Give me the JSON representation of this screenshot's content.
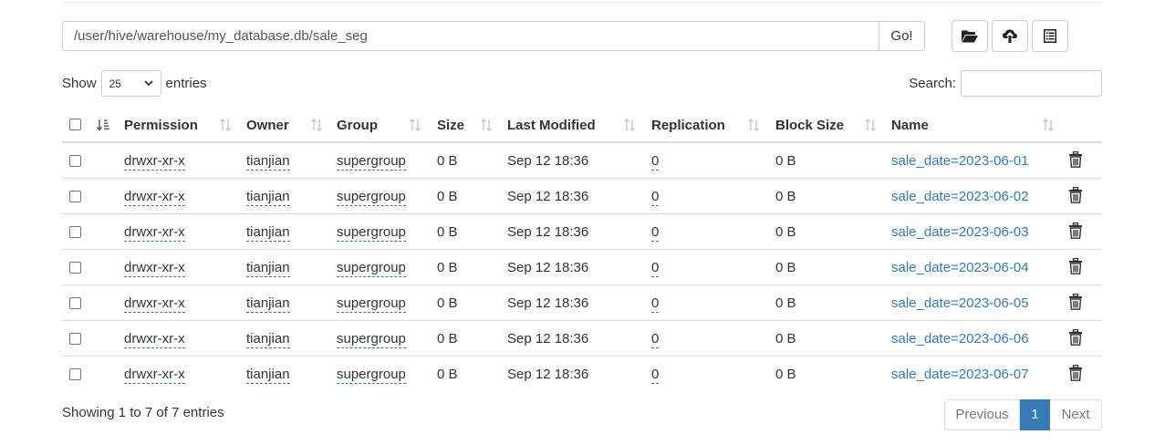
{
  "path": {
    "value": "/user/hive/warehouse/my_database.db/sale_seg",
    "go_label": "Go!"
  },
  "toolbar": {
    "browse_icon": "folder-open-icon",
    "upload_icon": "upload-icon",
    "list_icon": "list-icon"
  },
  "length": {
    "show_label": "Show",
    "selected": "25",
    "entries_label": "entries"
  },
  "search": {
    "label": "Search:",
    "value": ""
  },
  "table": {
    "headers": {
      "permission": "Permission",
      "owner": "Owner",
      "group": "Group",
      "size": "Size",
      "last_modified": "Last Modified",
      "replication": "Replication",
      "block_size": "Block Size",
      "name": "Name"
    },
    "rows": [
      {
        "permission": "drwxr-xr-x",
        "owner": "tianjian",
        "group": "supergroup",
        "size": "0 B",
        "last_modified": "Sep 12 18:36",
        "replication": "0",
        "block_size": "0 B",
        "name": "sale_date=2023-06-01"
      },
      {
        "permission": "drwxr-xr-x",
        "owner": "tianjian",
        "group": "supergroup",
        "size": "0 B",
        "last_modified": "Sep 12 18:36",
        "replication": "0",
        "block_size": "0 B",
        "name": "sale_date=2023-06-02"
      },
      {
        "permission": "drwxr-xr-x",
        "owner": "tianjian",
        "group": "supergroup",
        "size": "0 B",
        "last_modified": "Sep 12 18:36",
        "replication": "0",
        "block_size": "0 B",
        "name": "sale_date=2023-06-03"
      },
      {
        "permission": "drwxr-xr-x",
        "owner": "tianjian",
        "group": "supergroup",
        "size": "0 B",
        "last_modified": "Sep 12 18:36",
        "replication": "0",
        "block_size": "0 B",
        "name": "sale_date=2023-06-04"
      },
      {
        "permission": "drwxr-xr-x",
        "owner": "tianjian",
        "group": "supergroup",
        "size": "0 B",
        "last_modified": "Sep 12 18:36",
        "replication": "0",
        "block_size": "0 B",
        "name": "sale_date=2023-06-05"
      },
      {
        "permission": "drwxr-xr-x",
        "owner": "tianjian",
        "group": "supergroup",
        "size": "0 B",
        "last_modified": "Sep 12 18:36",
        "replication": "0",
        "block_size": "0 B",
        "name": "sale_date=2023-06-06"
      },
      {
        "permission": "drwxr-xr-x",
        "owner": "tianjian",
        "group": "supergroup",
        "size": "0 B",
        "last_modified": "Sep 12 18:36",
        "replication": "0",
        "block_size": "0 B",
        "name": "sale_date=2023-06-07"
      }
    ]
  },
  "footer": {
    "info": "Showing 1 to 7 of 7 entries",
    "previous": "Previous",
    "current_page": "1",
    "next": "Next"
  },
  "colors": {
    "link": "#337ab7",
    "active_page": "#337ab7",
    "border": "#dddddd"
  }
}
